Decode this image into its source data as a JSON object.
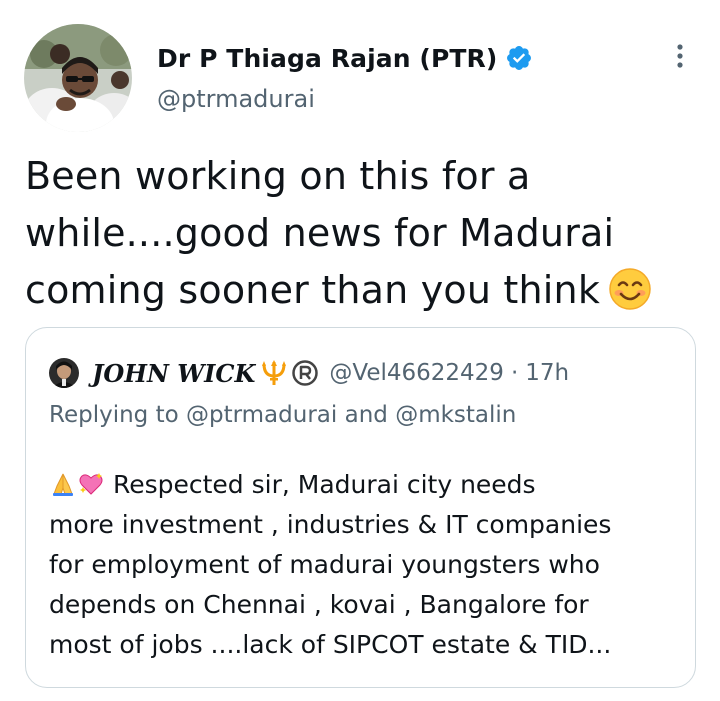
{
  "tweet": {
    "author": {
      "display_name": "Dr P Thiaga Rajan (PTR)",
      "handle": "@ptrmadurai",
      "verified": true
    },
    "text_lines": [
      "Been working on this for a",
      "while....good news for Madurai",
      "coming sooner than you think"
    ],
    "text_emoji": "smiling-face-icon",
    "more_icon": "more-options-icon"
  },
  "quoted_tweet": {
    "author": {
      "display_name": "JOHN WICK",
      "name_badges": [
        "trident-icon",
        "registered-icon"
      ],
      "handle": "@Vel46622429",
      "separator": "·",
      "time": "17h"
    },
    "replying_to": {
      "prefix": "Replying to",
      "user1": "@ptrmadurai",
      "conjunction": "and",
      "user2": "@mkstalin"
    },
    "body_lines": [
      "Respected sir,   Madurai city needs",
      "more investment , industries & IT companies",
      "for employment of madurai youngsters who",
      "depends on Chennai , kovai , Bangalore for",
      "most of jobs ....lack of SIPCOT estate & TID..."
    ],
    "body_emojis": [
      "folded-hands-icon",
      "sparkling-heart-icon"
    ]
  },
  "colors": {
    "text_primary": "#0f1419",
    "text_secondary": "#536471",
    "verified_blue": "#1d9bf0",
    "border": "#cfd9de",
    "trident_orange": "#f59e0b"
  }
}
